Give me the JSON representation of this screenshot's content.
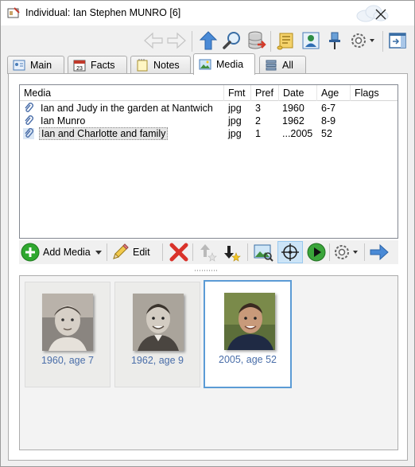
{
  "window": {
    "title": "Individual: Ian Stephen MUNRO [6]"
  },
  "toolbar": {
    "buttons": [
      {
        "name": "back-arrow-icon",
        "enabled": false
      },
      {
        "name": "forward-arrow-icon",
        "enabled": false
      },
      {
        "name": "up-arrow-icon",
        "enabled": true
      },
      {
        "name": "search-icon",
        "enabled": true
      },
      {
        "name": "database-icon",
        "enabled": true
      },
      {
        "name": "report-scroll-icon",
        "enabled": true
      },
      {
        "name": "people-icon",
        "enabled": true
      },
      {
        "name": "pin-icon",
        "enabled": true
      },
      {
        "name": "gear-dropdown-icon",
        "enabled": true
      },
      {
        "name": "window-sidebar-icon",
        "enabled": true
      }
    ]
  },
  "tabs": [
    {
      "label": "Main",
      "icon": "person-card-icon",
      "active": false
    },
    {
      "label": "Facts",
      "icon": "calendar-icon",
      "active": false,
      "icon_text": "23"
    },
    {
      "label": "Notes",
      "icon": "notepad-icon",
      "active": false
    },
    {
      "label": "Media",
      "icon": "picture-icon",
      "active": true
    },
    {
      "label": "All",
      "icon": "list-icon",
      "active": false
    }
  ],
  "media_list": {
    "columns": [
      "Media",
      "Fmt",
      "Pref",
      "Date",
      "Age",
      "Flags"
    ],
    "rows": [
      {
        "name": "Ian and Judy in the garden at Nantwich",
        "fmt": "jpg",
        "pref": "3",
        "date": "1960",
        "age": "6-7",
        "flags": "",
        "selected": false
      },
      {
        "name": "Ian Munro",
        "fmt": "jpg",
        "pref": "2",
        "date": "1962",
        "age": "8-9",
        "flags": "",
        "selected": false
      },
      {
        "name": "Ian and Charlotte and family",
        "fmt": "jpg",
        "pref": "1",
        "date": "...2005",
        "age": "52",
        "flags": "",
        "selected": true
      }
    ]
  },
  "media_toolbar": {
    "add_media_label": "Add Media",
    "edit_label": "Edit"
  },
  "thumbnails": [
    {
      "caption": "1960, age 7",
      "selected": false
    },
    {
      "caption": "1962, age 9",
      "selected": false
    },
    {
      "caption": "2005, age 52",
      "selected": true
    }
  ],
  "colors": {
    "accent_blue": "#5b9bd5",
    "caption_blue": "#4a6ea9",
    "add_green": "#2fa82f",
    "delete_red": "#d9322a"
  }
}
